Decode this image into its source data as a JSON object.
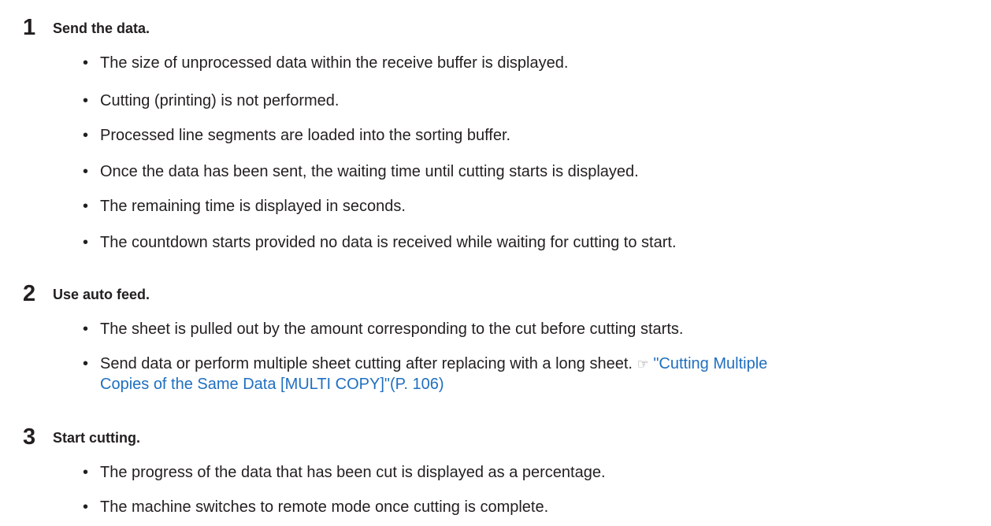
{
  "steps": [
    {
      "number": "1",
      "title": "Send the data.",
      "bullets": [
        "The size of unprocessed data within the receive buffer is displayed.",
        "Cutting (printing) is not performed.",
        "Processed line segments are loaded into the sorting buffer.",
        "Once the data has been sent, the waiting time until cutting starts is displayed.",
        "The remaining time is displayed in seconds.",
        "The countdown starts provided no data is received while waiting for cutting to start."
      ]
    },
    {
      "number": "2",
      "title": "Use auto feed.",
      "bullets": [
        "The sheet is pulled out by the amount corresponding to the cut before cutting starts."
      ],
      "reference_bullet": {
        "text": "Send data or perform multiple sheet cutting after replacing with a long sheet.",
        "ref_symbol": "☞",
        "link_line1": "\"Cutting Multiple",
        "link_line2": "Copies of the Same Data [MULTI COPY]\"(P. 106)"
      }
    },
    {
      "number": "3",
      "title": "Start cutting.",
      "bullets": [
        "The progress of the data that has been cut is displayed as a percentage.",
        "The machine switches to remote mode once cutting is complete."
      ]
    }
  ]
}
